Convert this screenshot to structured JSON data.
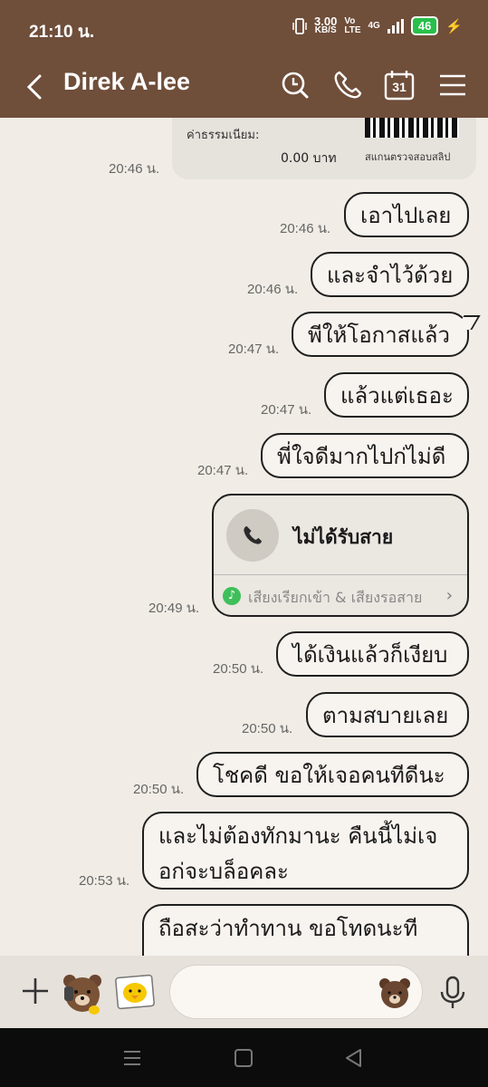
{
  "status": {
    "time": "21:10 น.",
    "speed": "3.00",
    "speed_unit": "KB/S",
    "volte_top": "Vo",
    "volte_bottom": "LTE",
    "network": "4G",
    "battery": "46"
  },
  "header": {
    "title": "Direk A-lee",
    "calendar_day": "31"
  },
  "top_card": {
    "fee_label": "ค่าธรรมเนียม:",
    "fee_value": "0.00 บาท",
    "slip_label": "สแกนตรวจสอบสลิป",
    "time": "20:46 น."
  },
  "messages": [
    {
      "text": "เอาไปเลย",
      "time": "20:46 น."
    },
    {
      "text": "และจำไว้ด้วย",
      "time": "20:46 น."
    },
    {
      "text": "พีให้โอกาสแล้ว",
      "time": "20:47 น."
    },
    {
      "text": "แล้วแต่เธอะ",
      "time": "20:47 น."
    },
    {
      "text": "พี่ใจดีมากไปก่ไม่ดี",
      "time": "20:47 น."
    },
    {
      "text": "ได้เงินแล้วก็เงียบ",
      "time": "20:50 น."
    },
    {
      "text": "ตามสบายเลย",
      "time": "20:50 น."
    },
    {
      "text": "โชคดี ขอให้เจอคนทีดีนะ",
      "time": "20:50 น."
    },
    {
      "text": "และไม่ต้องทักมานะ คืนนี้ไม่เจอก่จะบล็อคละ",
      "time": "20:53 น."
    },
    {
      "text": "ถือสะว่าทำทาน ขอโทดนะที"
    }
  ],
  "call_card": {
    "title": "ไม่ได้รับสาย",
    "subtitle": "เสียงเรียกเข้า & เสียงรอสาย",
    "time": "20:49 น."
  },
  "input": {
    "placeholder": ""
  }
}
